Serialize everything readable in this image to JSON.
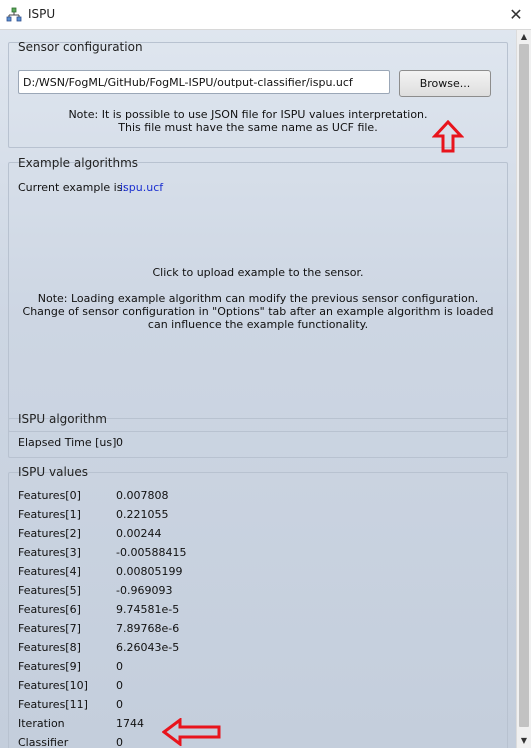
{
  "window": {
    "title": "ISPU",
    "close_glyph": "✕"
  },
  "sensor_configuration": {
    "title": "Sensor configuration",
    "path_value": "D:/WSN/FogML/GitHub/FogML-ISPU/output-classifier/ispu.ucf",
    "browse_label": "Browse...",
    "note_line1": "Note: It is possible to use JSON file for ISPU values interpretation.",
    "note_line2": "This file must have the same name as UCF file."
  },
  "example_algorithms": {
    "title": "Example algorithms",
    "current_label": "Current example is:",
    "current_value": "ispu.ucf",
    "click_text": "Click to upload example to the sensor.",
    "note_line1": "Note: Loading example algorithm can modify the previous sensor configuration.",
    "note_line2": "Change of sensor configuration in \"Options\" tab after an example algorithm is loaded",
    "note_line3": "can influence the example functionality."
  },
  "ispu_algorithm": {
    "title": "ISPU algorithm",
    "elapsed_label": "Elapsed Time [us]",
    "elapsed_value": "0"
  },
  "ispu_values": {
    "title": "ISPU values",
    "rows": [
      {
        "label": "Features[0]",
        "value": "0.007808"
      },
      {
        "label": "Features[1]",
        "value": "0.221055"
      },
      {
        "label": "Features[2]",
        "value": "0.00244"
      },
      {
        "label": "Features[3]",
        "value": "-0.00588415"
      },
      {
        "label": "Features[4]",
        "value": "0.00805199"
      },
      {
        "label": "Features[5]",
        "value": "-0.969093"
      },
      {
        "label": "Features[6]",
        "value": "9.74581e-5"
      },
      {
        "label": "Features[7]",
        "value": "7.89768e-6"
      },
      {
        "label": "Features[8]",
        "value": "6.26043e-5"
      },
      {
        "label": "Features[9]",
        "value": "0"
      },
      {
        "label": "Features[10]",
        "value": "0"
      },
      {
        "label": "Features[11]",
        "value": "0"
      },
      {
        "label": "Iteration",
        "value": "1744"
      },
      {
        "label": "Classifier",
        "value": "0"
      }
    ]
  },
  "colors": {
    "annotation_arrow": "#e8141c",
    "link": "#1a2fd0"
  },
  "icons": {
    "app": "network-icon",
    "annotation": "red-arrow-icon"
  }
}
